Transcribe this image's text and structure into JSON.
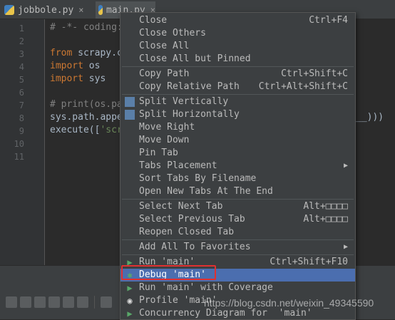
{
  "tabs": [
    {
      "label": "jobbole.py",
      "close": "×"
    },
    {
      "label": "main.py",
      "close": "×"
    }
  ],
  "line_numbers": [
    "1",
    "2",
    "3",
    "4",
    "5",
    "6",
    "7",
    "8",
    "9",
    "10",
    "11"
  ],
  "code": {
    "l1": "# -*- coding:",
    "l3_kw": "from",
    "l3_rest": " scrapy.c",
    "l4_kw": "import",
    "l4_rest": " os",
    "l5_kw": "import",
    "l5_rest": " sys",
    "l7": "# print(os.pa",
    "l8": "sys.path.appe",
    "l8_tail": "__)))",
    "l9_a": "execute([",
    "l9_str": "'scr"
  },
  "menu": {
    "items": [
      {
        "label": "Close",
        "shortcut": "Ctrl+F4"
      },
      {
        "label": "Close Others",
        "shortcut": ""
      },
      {
        "label": "Close All",
        "shortcut": ""
      },
      {
        "label": "Close All but Pinned",
        "shortcut": ""
      },
      {
        "label": "Copy Path",
        "shortcut": "Ctrl+Shift+C"
      },
      {
        "label": "Copy Relative Path",
        "shortcut": "Ctrl+Alt+Shift+C"
      },
      {
        "label": "Split Vertically",
        "shortcut": ""
      },
      {
        "label": "Split Horizontally",
        "shortcut": ""
      },
      {
        "label": "Move Right",
        "shortcut": ""
      },
      {
        "label": "Move Down",
        "shortcut": ""
      },
      {
        "label": "Pin Tab",
        "shortcut": ""
      },
      {
        "label": "Tabs Placement",
        "shortcut": ""
      },
      {
        "label": "Sort Tabs By Filename",
        "shortcut": ""
      },
      {
        "label": "Open New Tabs At The End",
        "shortcut": ""
      },
      {
        "label": "Select Next Tab",
        "shortcut": "Alt+□□□□"
      },
      {
        "label": "Select Previous Tab",
        "shortcut": "Alt+□□□□"
      },
      {
        "label": "Reopen Closed Tab",
        "shortcut": ""
      },
      {
        "label": "Add All To Favorites",
        "shortcut": ""
      },
      {
        "label": "Run 'main'",
        "shortcut": "Ctrl+Shift+F10"
      },
      {
        "label": "Debug 'main'",
        "shortcut": ""
      },
      {
        "label": "Run 'main' with Coverage",
        "shortcut": ""
      },
      {
        "label": "Profile 'main'",
        "shortcut": ""
      },
      {
        "label": "Concurrency Diagram for  'main'",
        "shortcut": ""
      }
    ],
    "submenu_arrow": "▶"
  },
  "colors": {
    "selection": "#4b6eaf",
    "highlight_box": "#e03030"
  },
  "watermark": "https://blog.csdn.net/weixin_49345590"
}
